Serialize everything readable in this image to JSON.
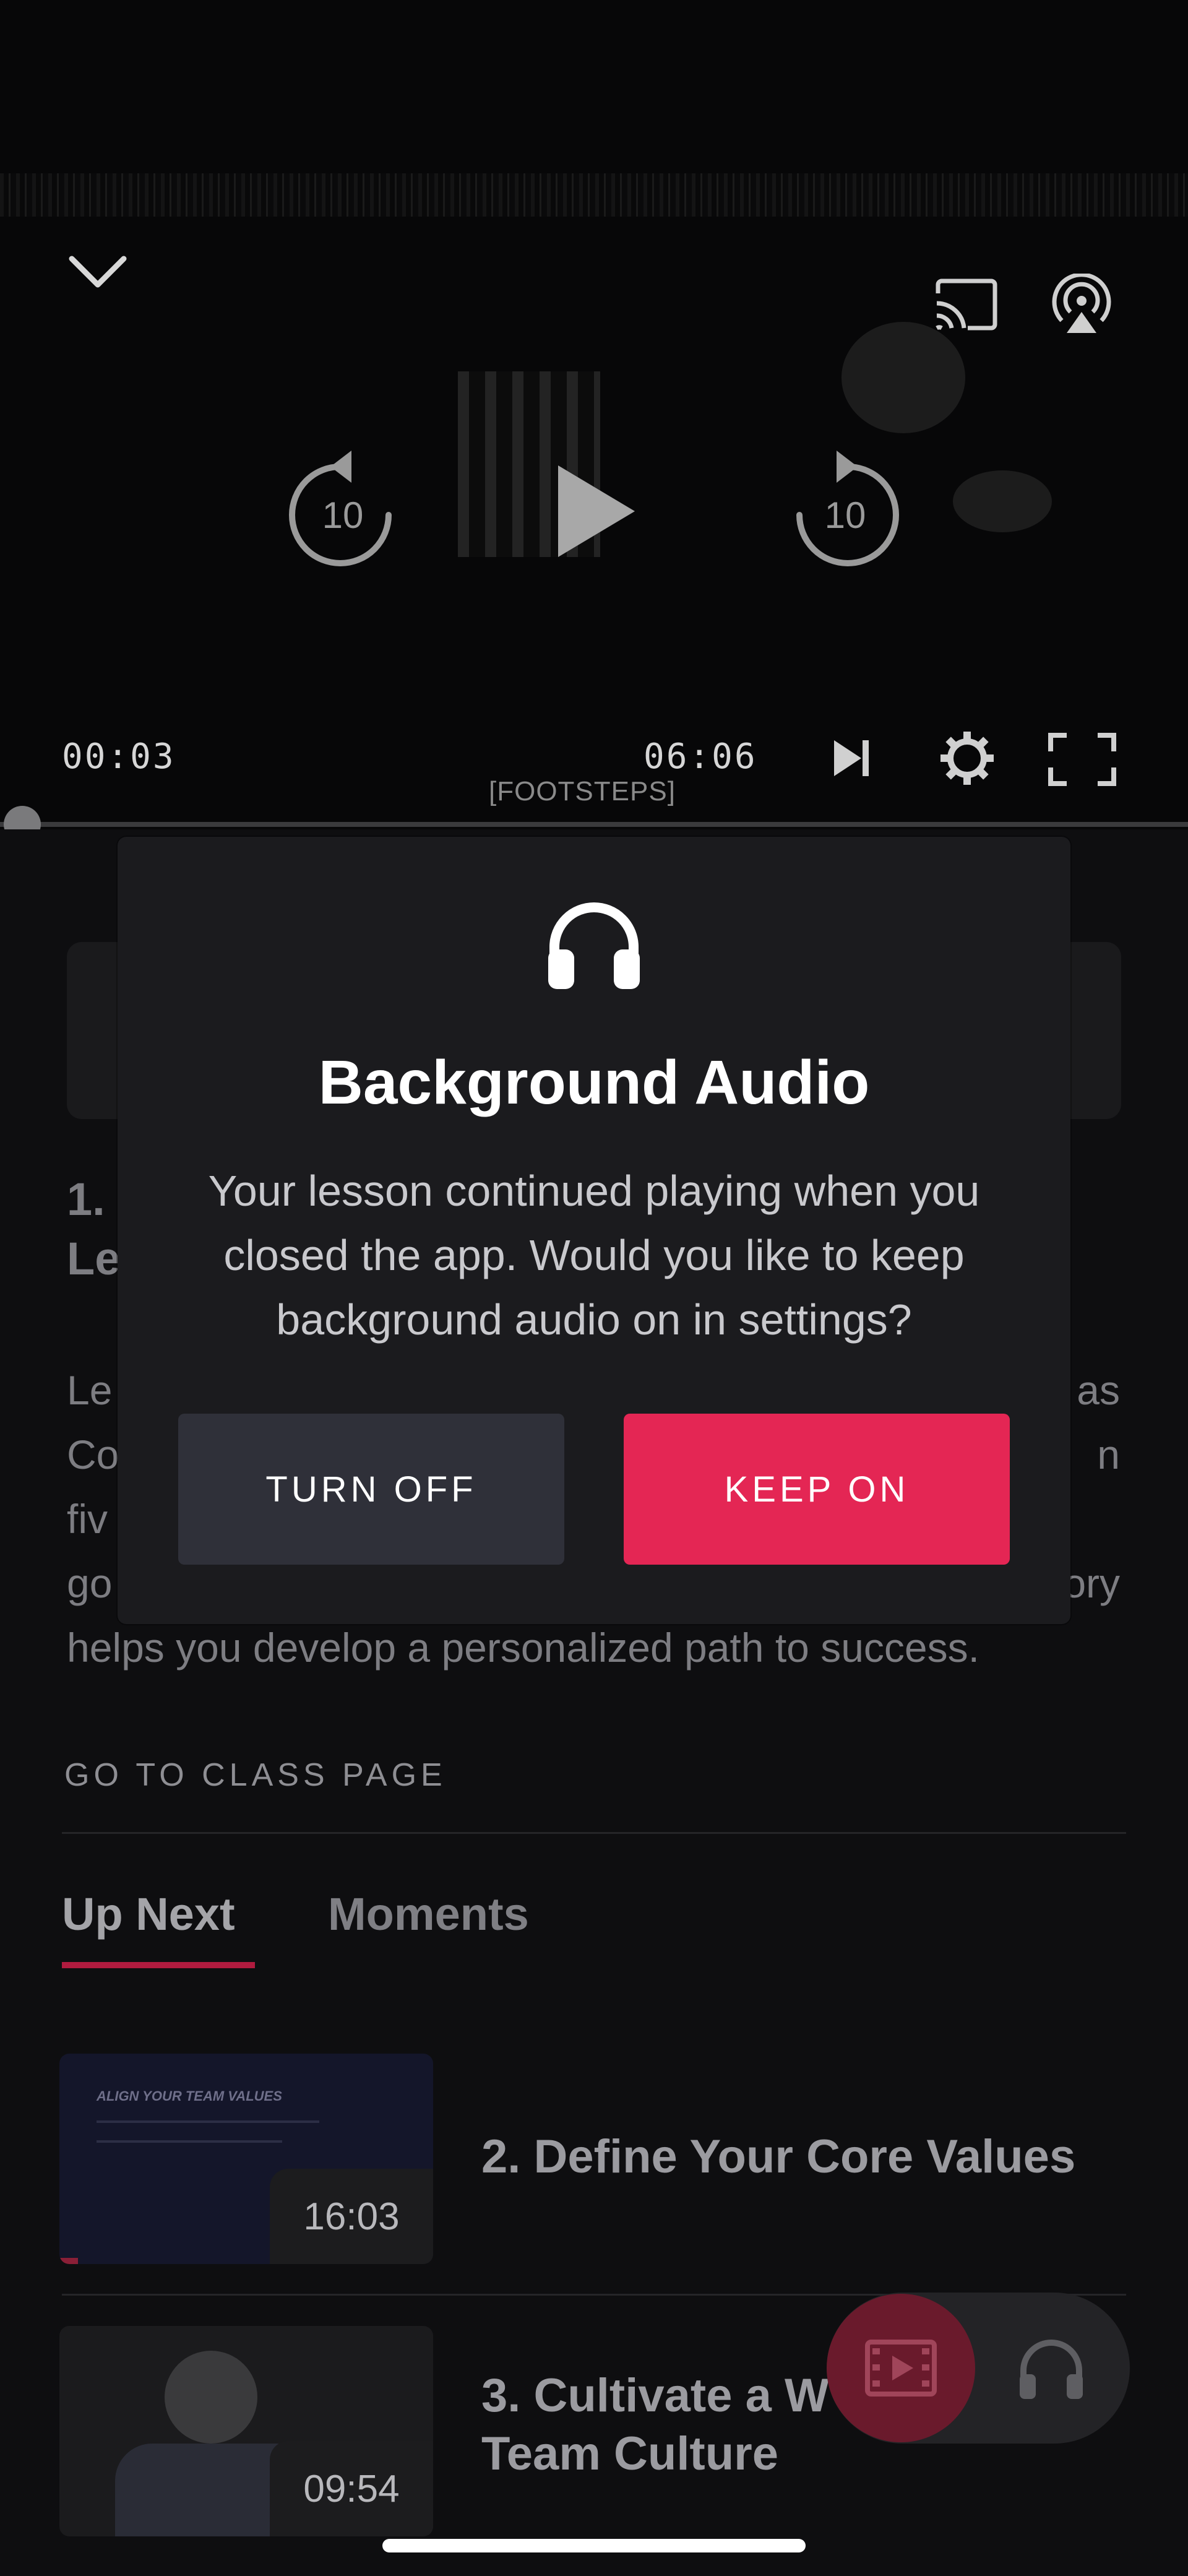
{
  "player": {
    "current_time": "00:03",
    "total_time": "06:06",
    "caption": "[FOOTSTEPS]",
    "rewind_seconds": "10",
    "forward_seconds": "10",
    "icons": [
      "chevron-down-icon",
      "cast-icon",
      "airplay-icon",
      "rewind-10-icon",
      "play-icon",
      "forward-10-icon",
      "skip-next-icon",
      "settings-gear-icon",
      "fullscreen-icon"
    ]
  },
  "lesson": {
    "heading_line1": "1.",
    "heading_line2": "Le",
    "description_lines": [
      "Le",
      "Co",
      "fiv",
      "go",
      "helps you develop a personalized path to success."
    ],
    "description_right": [
      "as",
      "n",
      "",
      "ory"
    ]
  },
  "class_link": "GO TO CLASS PAGE",
  "tabs": [
    {
      "label": "Up Next",
      "active": true
    },
    {
      "label": "Moments",
      "active": false
    }
  ],
  "up_next": [
    {
      "title": "2. Define Your Core Values",
      "duration": "16:03",
      "thumb_heading": "ALIGN YOUR TEAM VALUES"
    },
    {
      "title_line1": "3. Cultivate a W",
      "title_line2": "Team Culture",
      "duration": "09:54"
    }
  ],
  "modal": {
    "icon": "headphones-icon",
    "title": "Background Audio",
    "body": "Your lesson continued playing when you closed the app. Would you like to keep background audio on in settings?",
    "turn_off_label": "TURN OFF",
    "keep_on_label": "KEEP ON"
  },
  "colors": {
    "accent": "#e42654",
    "modal_bg": "#1b1b1e",
    "secondary_button": "#2f3039"
  }
}
